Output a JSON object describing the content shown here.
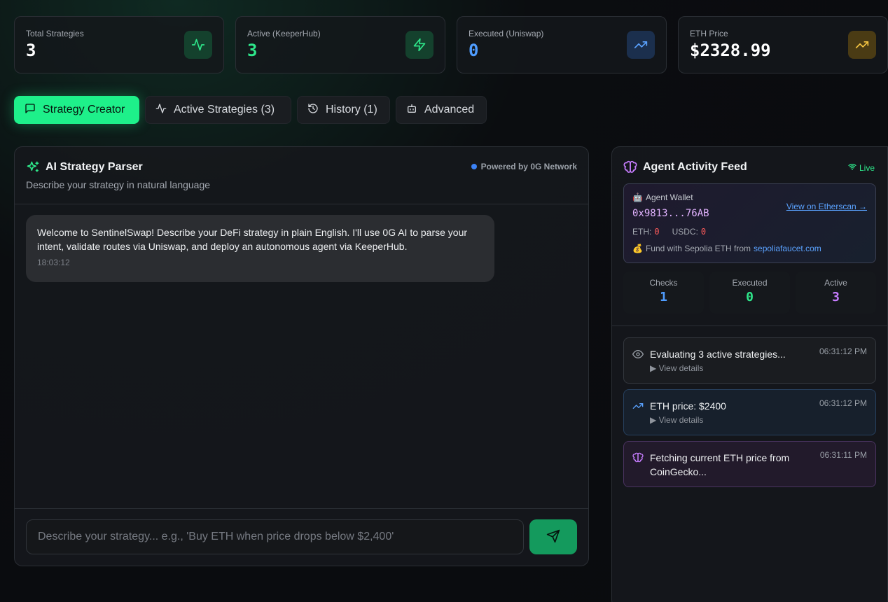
{
  "stats": [
    {
      "label": "Total Strategies",
      "value": "3",
      "value_color": "#ffffff",
      "icon": "activity-icon",
      "icon_color": "#2ee68a",
      "icon_bg": "#14412d"
    },
    {
      "label": "Active (KeeperHub)",
      "value": "3",
      "value_color": "#2ee68a",
      "icon": "zap-icon",
      "icon_color": "#2ee68a",
      "icon_bg": "#14412d"
    },
    {
      "label": "Executed (Uniswap)",
      "value": "0",
      "value_color": "#4f9dff",
      "icon": "trending-up-icon",
      "icon_color": "#5aa2ff",
      "icon_bg": "#1b2f4d"
    },
    {
      "label": "ETH Price",
      "value": "$2328.99",
      "value_color": "#ffffff",
      "icon": "trending-up-icon",
      "icon_color": "#f5c542",
      "icon_bg": "#4a3b14"
    }
  ],
  "tabs": [
    {
      "label": "Strategy Creator",
      "icon": "message-square-icon",
      "active": true
    },
    {
      "label": "Active Strategies (3)",
      "icon": "activity-icon",
      "active": false
    },
    {
      "label": "History (1)",
      "icon": "history-icon",
      "active": false
    },
    {
      "label": "Advanced",
      "icon": "bot-icon",
      "active": false
    }
  ],
  "parser": {
    "title": "AI Strategy Parser",
    "subtitle": "Describe your strategy in natural language",
    "powered_by": "Powered by 0G Network",
    "message": {
      "text": "Welcome to SentinelSwap! Describe your DeFi strategy in plain English. I'll use 0G AI to parse your intent, validate routes via Uniswap, and deploy an autonomous agent via KeeperHub.",
      "time": "18:03:12"
    },
    "input_placeholder": "Describe your strategy... e.g., 'Buy ETH when price drops below $2,400'",
    "input_value": ""
  },
  "feed": {
    "title": "Agent Activity Feed",
    "live_label": "Live",
    "wallet": {
      "emoji": "🤖",
      "label": "Agent Wallet",
      "address": "0x9813...76AB",
      "etherscan_link": "View on Etherscan →",
      "eth_label": "ETH:",
      "eth_value": "0",
      "usdc_label": "USDC:",
      "usdc_value": "0",
      "fund_emoji": "💰",
      "fund_text": "Fund with Sepolia ETH from",
      "fund_link": "sepoliafaucet.com"
    },
    "counters": [
      {
        "label": "Checks",
        "value": "1",
        "color": "#4f9dff"
      },
      {
        "label": "Executed",
        "value": "0",
        "color": "#2ee68a"
      },
      {
        "label": "Active",
        "value": "3",
        "color": "#c77dff"
      }
    ],
    "events": [
      {
        "text": "Evaluating 3 active strategies...",
        "time": "06:31:12 PM",
        "details": "▶ View details",
        "icon": "eye-icon"
      },
      {
        "text": "ETH price: $2400",
        "time": "06:31:12 PM",
        "details": "▶ View details",
        "icon": "trending-up-icon"
      },
      {
        "text": "Fetching current ETH price from CoinGecko...",
        "time": "06:31:11 PM",
        "details": "",
        "icon": "brain-icon"
      }
    ]
  }
}
